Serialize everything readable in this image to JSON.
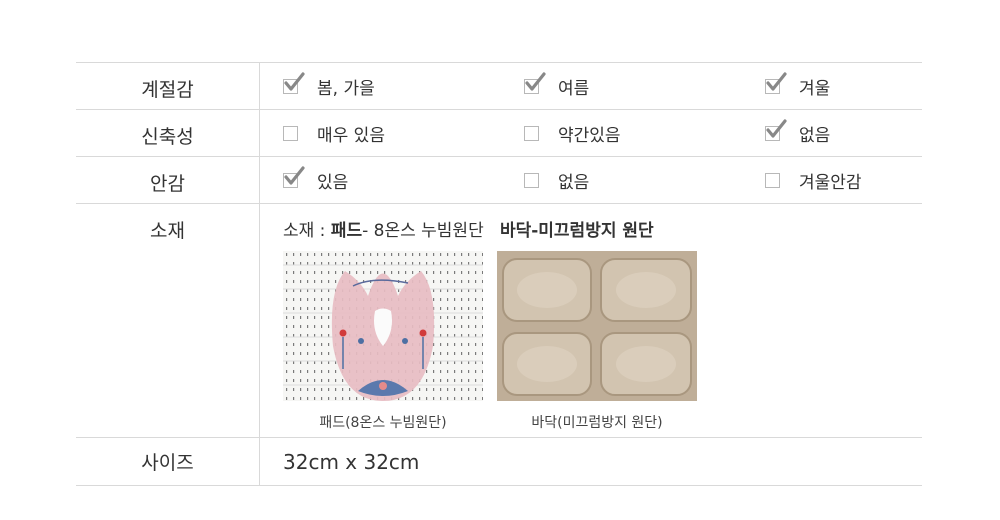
{
  "rows": [
    {
      "label": "계절감",
      "options": [
        {
          "text": "봄, 가을",
          "checked": true
        },
        {
          "text": "여름",
          "checked": true
        },
        {
          "text": "겨울",
          "checked": true
        }
      ]
    },
    {
      "label": "신축성",
      "options": [
        {
          "text": "매우 있음",
          "checked": false
        },
        {
          "text": "약간있음",
          "checked": false
        },
        {
          "text": "없음",
          "checked": true
        }
      ]
    },
    {
      "label": "안감",
      "options": [
        {
          "text": "있음",
          "checked": true
        },
        {
          "text": "없음",
          "checked": false
        },
        {
          "text": "겨울안감",
          "checked": false
        }
      ]
    }
  ],
  "material": {
    "label": "소재",
    "title_prefix": "소재 : ",
    "pad_bold": "패드",
    "pad_rest": "- 8온스 누빔원단",
    "floor_bold": "바닥",
    "floor_rest": "-미끄럼방지 원단",
    "pad_caption": "패드(8온스 누빔원단)",
    "floor_caption": "바닥(미끄럼방지 원단)"
  },
  "size": {
    "label": "사이즈",
    "value": "32cm x 32cm"
  },
  "colors": {
    "border": "#d9d9d9",
    "text": "#333333",
    "check": "#888888"
  }
}
